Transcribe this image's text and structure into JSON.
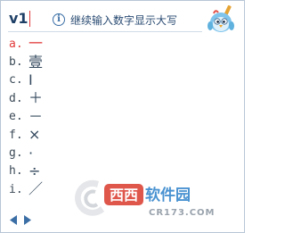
{
  "composition": {
    "text": "v1"
  },
  "hint": {
    "icon": "info-icon",
    "text": "继续输入数字显示大写"
  },
  "candidates": [
    {
      "key": "a.",
      "char": "一",
      "selected": true
    },
    {
      "key": "b.",
      "char": "壹"
    },
    {
      "key": "c.",
      "char": "Ⅰ"
    },
    {
      "key": "d.",
      "char": "＋"
    },
    {
      "key": "e.",
      "char": "－"
    },
    {
      "key": "f.",
      "char": "×"
    },
    {
      "key": "g.",
      "char": "·"
    },
    {
      "key": "h.",
      "char": "÷"
    },
    {
      "key": "i.",
      "char": "／"
    }
  ],
  "pager": {
    "prev_icon": "triangle-left-icon",
    "next_icon": "triangle-right-icon"
  },
  "watermark": {
    "brand": "西西软件园",
    "site": "CR173.COM"
  },
  "colors": {
    "accent": "#e23b3b",
    "text": "#34495e",
    "hint": "#2b4c73",
    "pager": "#3a6ea5",
    "watermark_blue": "#2a7fc9",
    "watermark_red": "#d9382c"
  }
}
